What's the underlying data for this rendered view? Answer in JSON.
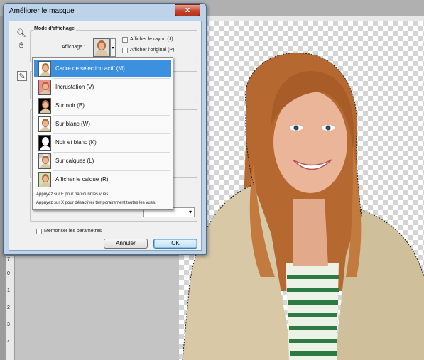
{
  "dialog": {
    "title": "Améliorer le masque",
    "close_label": "x",
    "view_mode": {
      "section_label": "Mode d'affichage",
      "view_label": "Affichage :",
      "show_radius": "Afficher le rayon (J)",
      "show_original": "Afficher l'original (P)"
    },
    "remember_label": "Mémoriser les paramètres",
    "cancel_label": "Annuler",
    "ok_label": "OK"
  },
  "menu": {
    "items": [
      {
        "label": "Cadre de sélection actif (M)",
        "bg": "#ffffff"
      },
      {
        "label": "Incrustation (V)",
        "bg": "#ef8f8f"
      },
      {
        "label": "Sur noir (B)",
        "bg": "#000000"
      },
      {
        "label": "Sur blanc (W)",
        "bg": "#ffffff"
      },
      {
        "label": "Noir et blanc (K)",
        "bg": "#000000"
      },
      {
        "label": "Sur calques (L)",
        "bg": "#eeeeee"
      },
      {
        "label": "Afficher le calque (R)",
        "bg": "#cfe3b5"
      }
    ],
    "selected_index": 0,
    "hint_1": "Appuyez sur F pour parcourir les vues.",
    "hint_2": "Appuyez sur X pour désactiver temporairement toutes les vues."
  },
  "ruler": {
    "labels": [
      "7",
      "0",
      "1",
      "2",
      "3",
      "4"
    ]
  },
  "colors": {
    "selected": "#3d8fe0",
    "dialog_frame": "#bcd3ea",
    "close_button": "#c5442c"
  }
}
